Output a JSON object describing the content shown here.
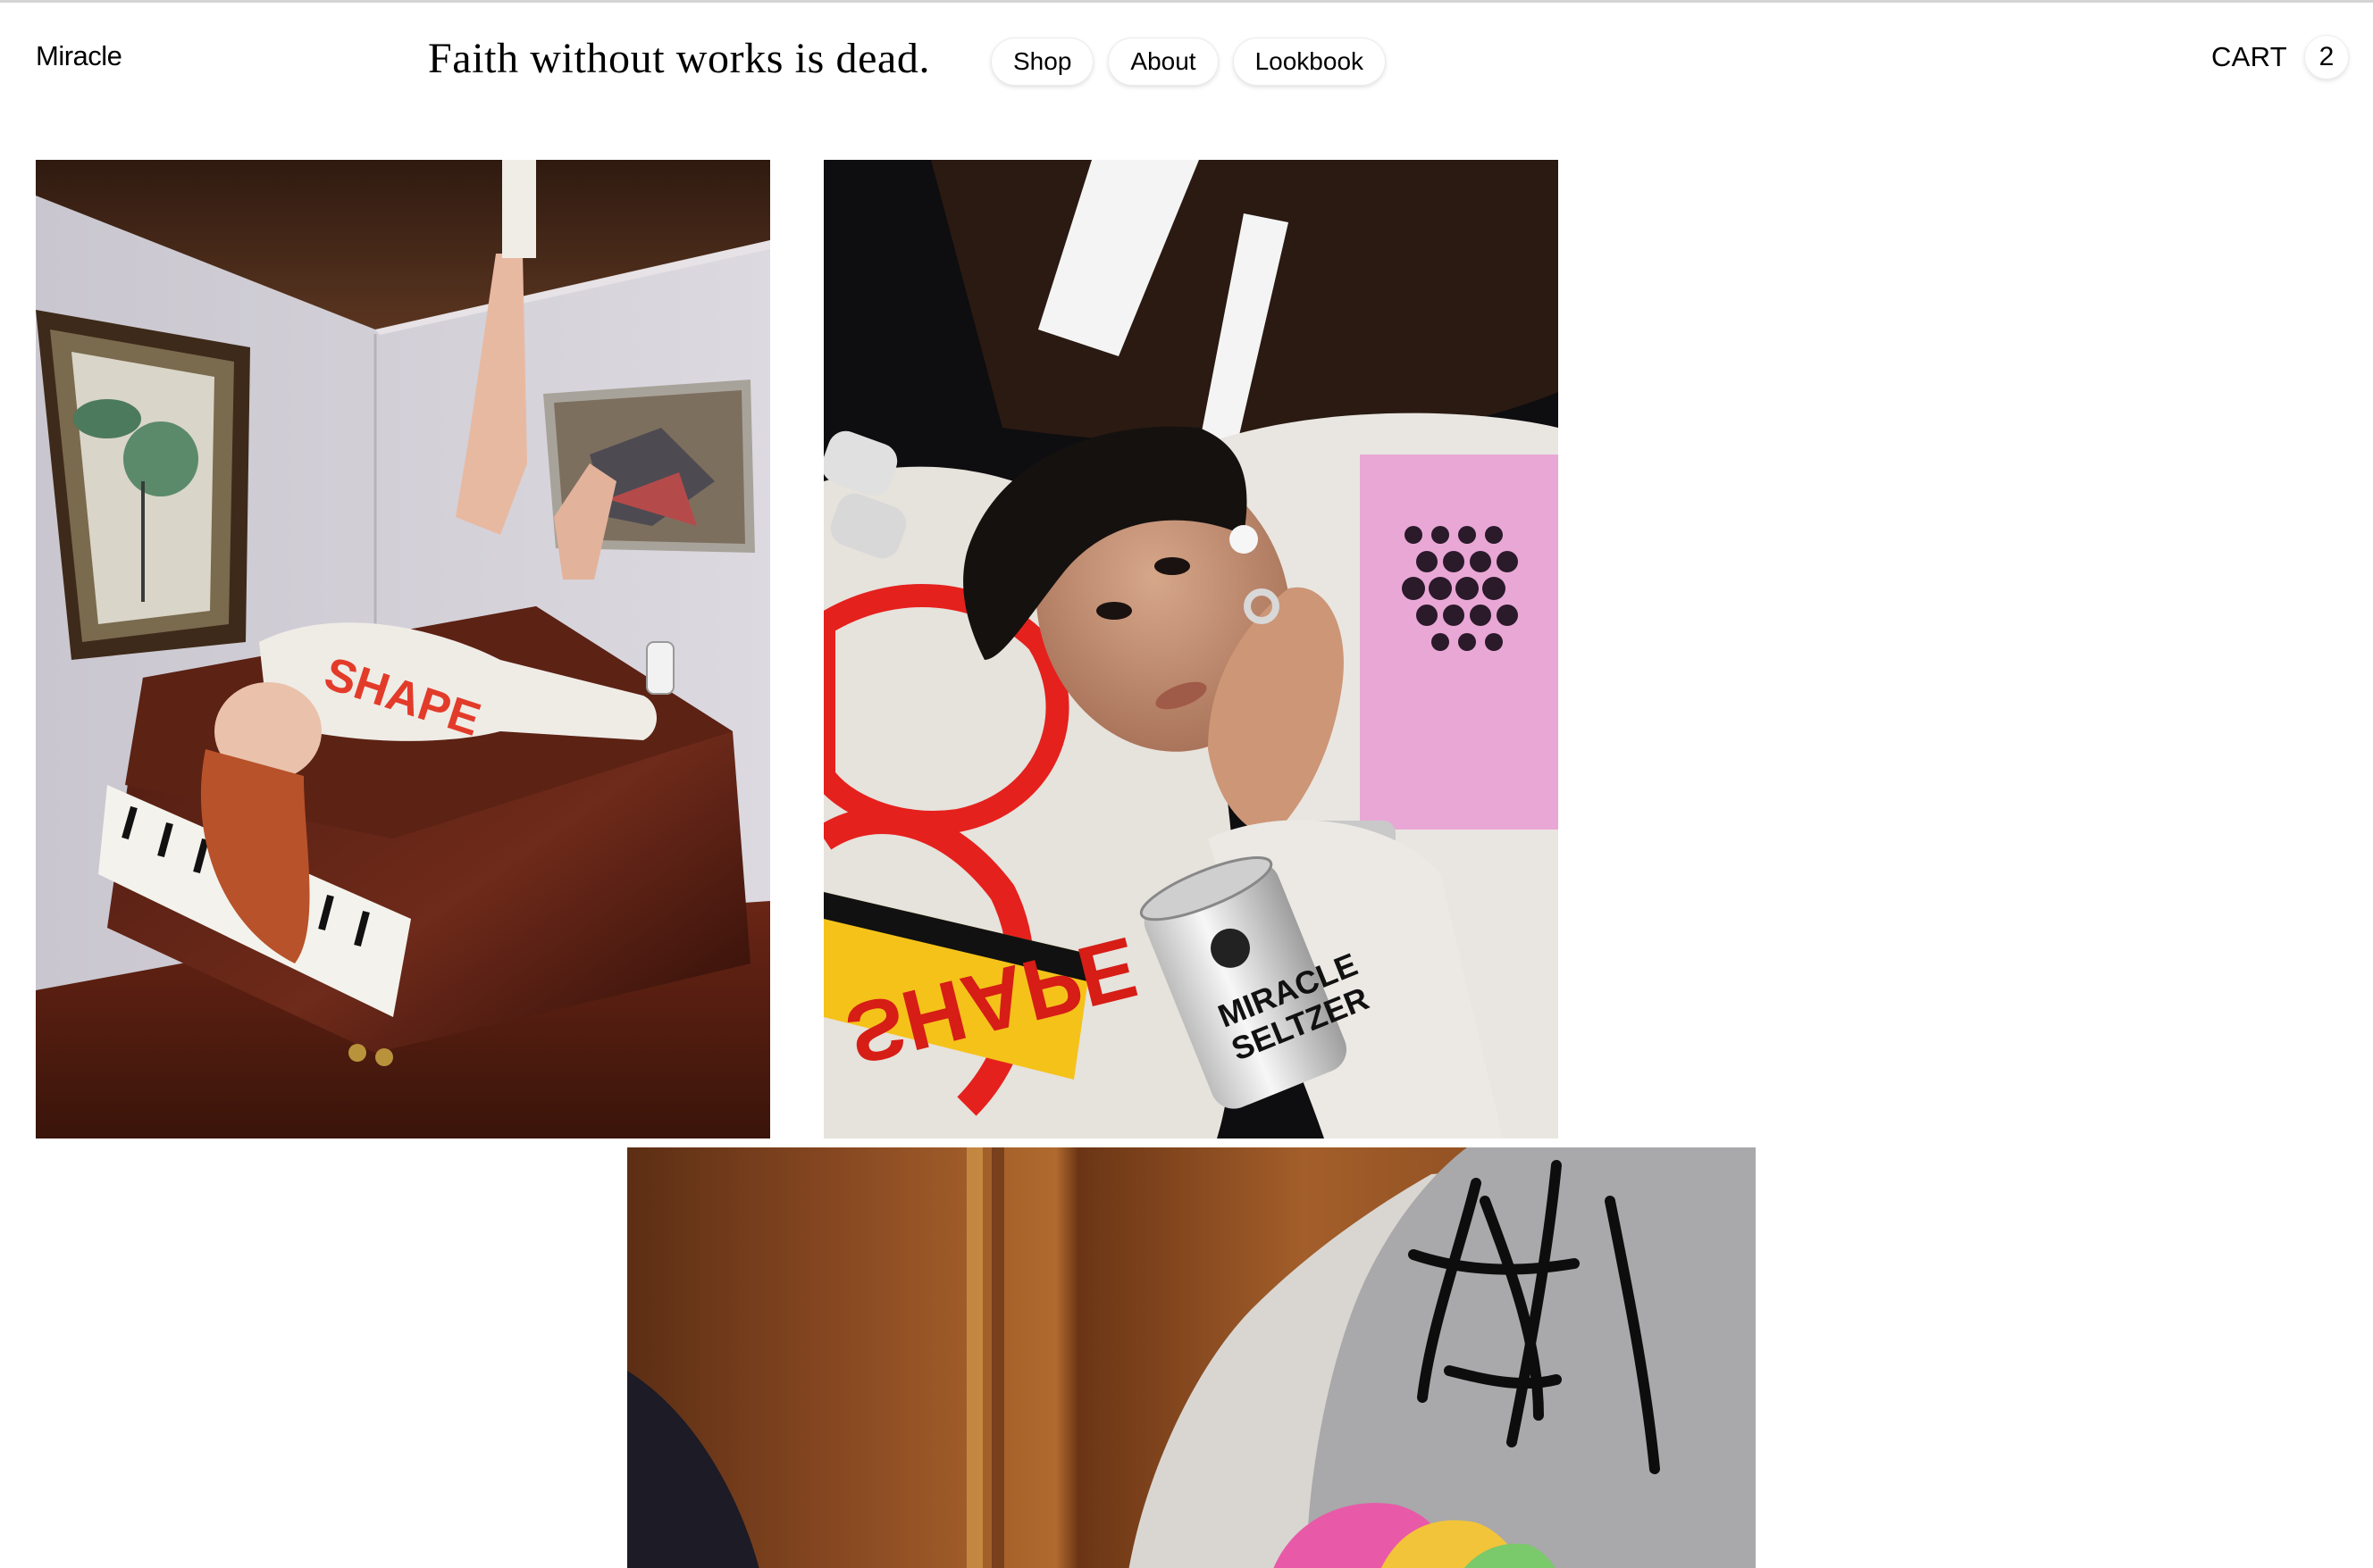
{
  "header": {
    "brand": "Miracle",
    "tagline": "Faith without works is dead.",
    "nav": [
      {
        "label": "Shop"
      },
      {
        "label": "About"
      },
      {
        "label": "Lookbook"
      }
    ],
    "cart": {
      "label": "CART",
      "count": "2"
    }
  },
  "gallery": {
    "photos": [
      {
        "subject": "model in white sweatshirt lying on a grand piano in a living room"
      },
      {
        "subject": "model in graphic sweatshirt with Miracle Seltzer can"
      },
      {
        "subject": "close-up of grey graphic t-shirt against wood paneling"
      }
    ],
    "print_text": {
      "shape": "SHAPE",
      "seltzer_line1": "MIRACLE",
      "seltzer_line2": "SELTZER"
    }
  },
  "colors": {
    "background": "#ffffff",
    "text": "#000000",
    "pill_border": "#e6e6e6"
  }
}
